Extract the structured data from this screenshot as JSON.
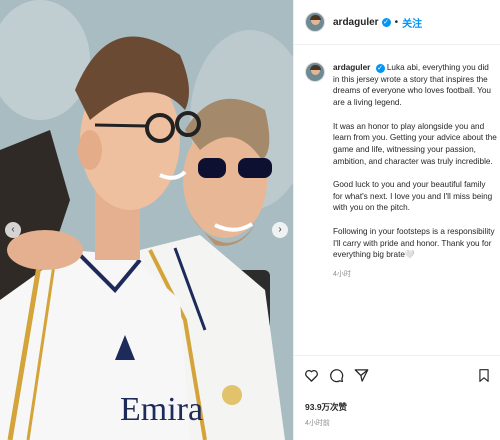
{
  "post": {
    "username": "ardaguler",
    "follow_label": "关注",
    "separator": "•",
    "verified_mark": "✓"
  },
  "media": {
    "description_icons": [
      "photo-of-two-players-icon"
    ],
    "prev_arrow": "‹",
    "next_arrow": "›"
  },
  "caption": {
    "username": "ardaguler",
    "paragraphs": [
      "Luka abi, everything you did in this jersey wrote a story that inspires the dreams of everyone who loves football. You are a living legend.",
      "It was an honor to play alongside you and learn from you. Getting your advice about the game and life, witnessing your passion, ambition, and character was truly incredible.",
      "Good luck to you and your beautiful family for what's next. I love you and I'll miss being with you on the pitch.",
      "Following in your footsteps is a responsibility I'll carry with pride and honor. Thank you for everything big brate🤍"
    ],
    "time": "4小时"
  },
  "footer": {
    "likes": "93.9万次赞",
    "posted": "4小时前"
  },
  "icons": {
    "like": "heart-icon",
    "comment": "comment-icon",
    "share": "share-icon",
    "save": "bookmark-icon"
  }
}
